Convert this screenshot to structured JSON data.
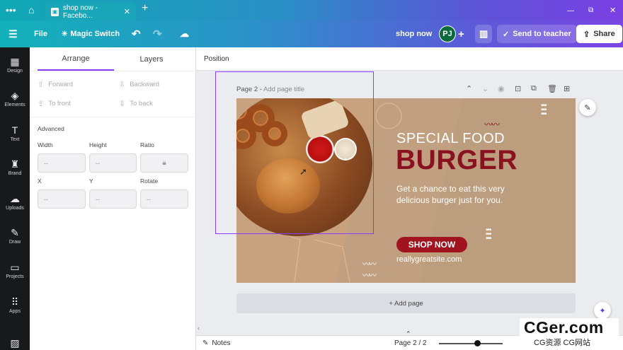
{
  "browser": {
    "tab_title": "shop now - Facebo...",
    "menu_icon": "dots-icon",
    "new_tab": "+"
  },
  "header": {
    "file": "File",
    "magic_switch": "Magic Switch",
    "doc_name": "shop now",
    "avatar_initials": "PJ",
    "send_to_teacher": "Send to teacher",
    "share": "Share"
  },
  "rail": [
    {
      "label": "Design",
      "icon": "design-icon"
    },
    {
      "label": "Elements",
      "icon": "elements-icon"
    },
    {
      "label": "Text",
      "icon": "text-icon"
    },
    {
      "label": "Brand",
      "icon": "brand-icon"
    },
    {
      "label": "Uploads",
      "icon": "uploads-icon"
    },
    {
      "label": "Draw",
      "icon": "draw-icon"
    },
    {
      "label": "Projects",
      "icon": "projects-icon"
    },
    {
      "label": "Apps",
      "icon": "apps-icon"
    }
  ],
  "panel": {
    "tabs": [
      "Arrange",
      "Layers"
    ],
    "active_tab": "Arrange",
    "forward": "Forward",
    "backward": "Backward",
    "to_front": "To front",
    "to_back": "To back",
    "advanced": "Advanced",
    "width_label": "Width",
    "height_label": "Height",
    "ratio_label": "Ratio",
    "x_label": "X",
    "y_label": "Y",
    "rotate_label": "Rotate",
    "empty": "--"
  },
  "canvas": {
    "toolbar_label": "Position",
    "page_label": "Page 2 -",
    "page_title_placeholder": "Add page title",
    "add_page": "+ Add page"
  },
  "design": {
    "special": "SPECIAL FOOD",
    "burger": "BURGER",
    "body": "Get a chance to eat this very delicious burger just for you.",
    "cta": "SHOP NOW",
    "site": "reallygreatsite.com",
    "colors": {
      "background": "#c8a17e",
      "accent": "#8a1220"
    }
  },
  "footer": {
    "notes": "Notes",
    "page_count": "Page 2 / 2",
    "zoom_level": 0.6
  },
  "watermark": {
    "main": "CGer.com",
    "sub": "CG资源 CG网站"
  }
}
